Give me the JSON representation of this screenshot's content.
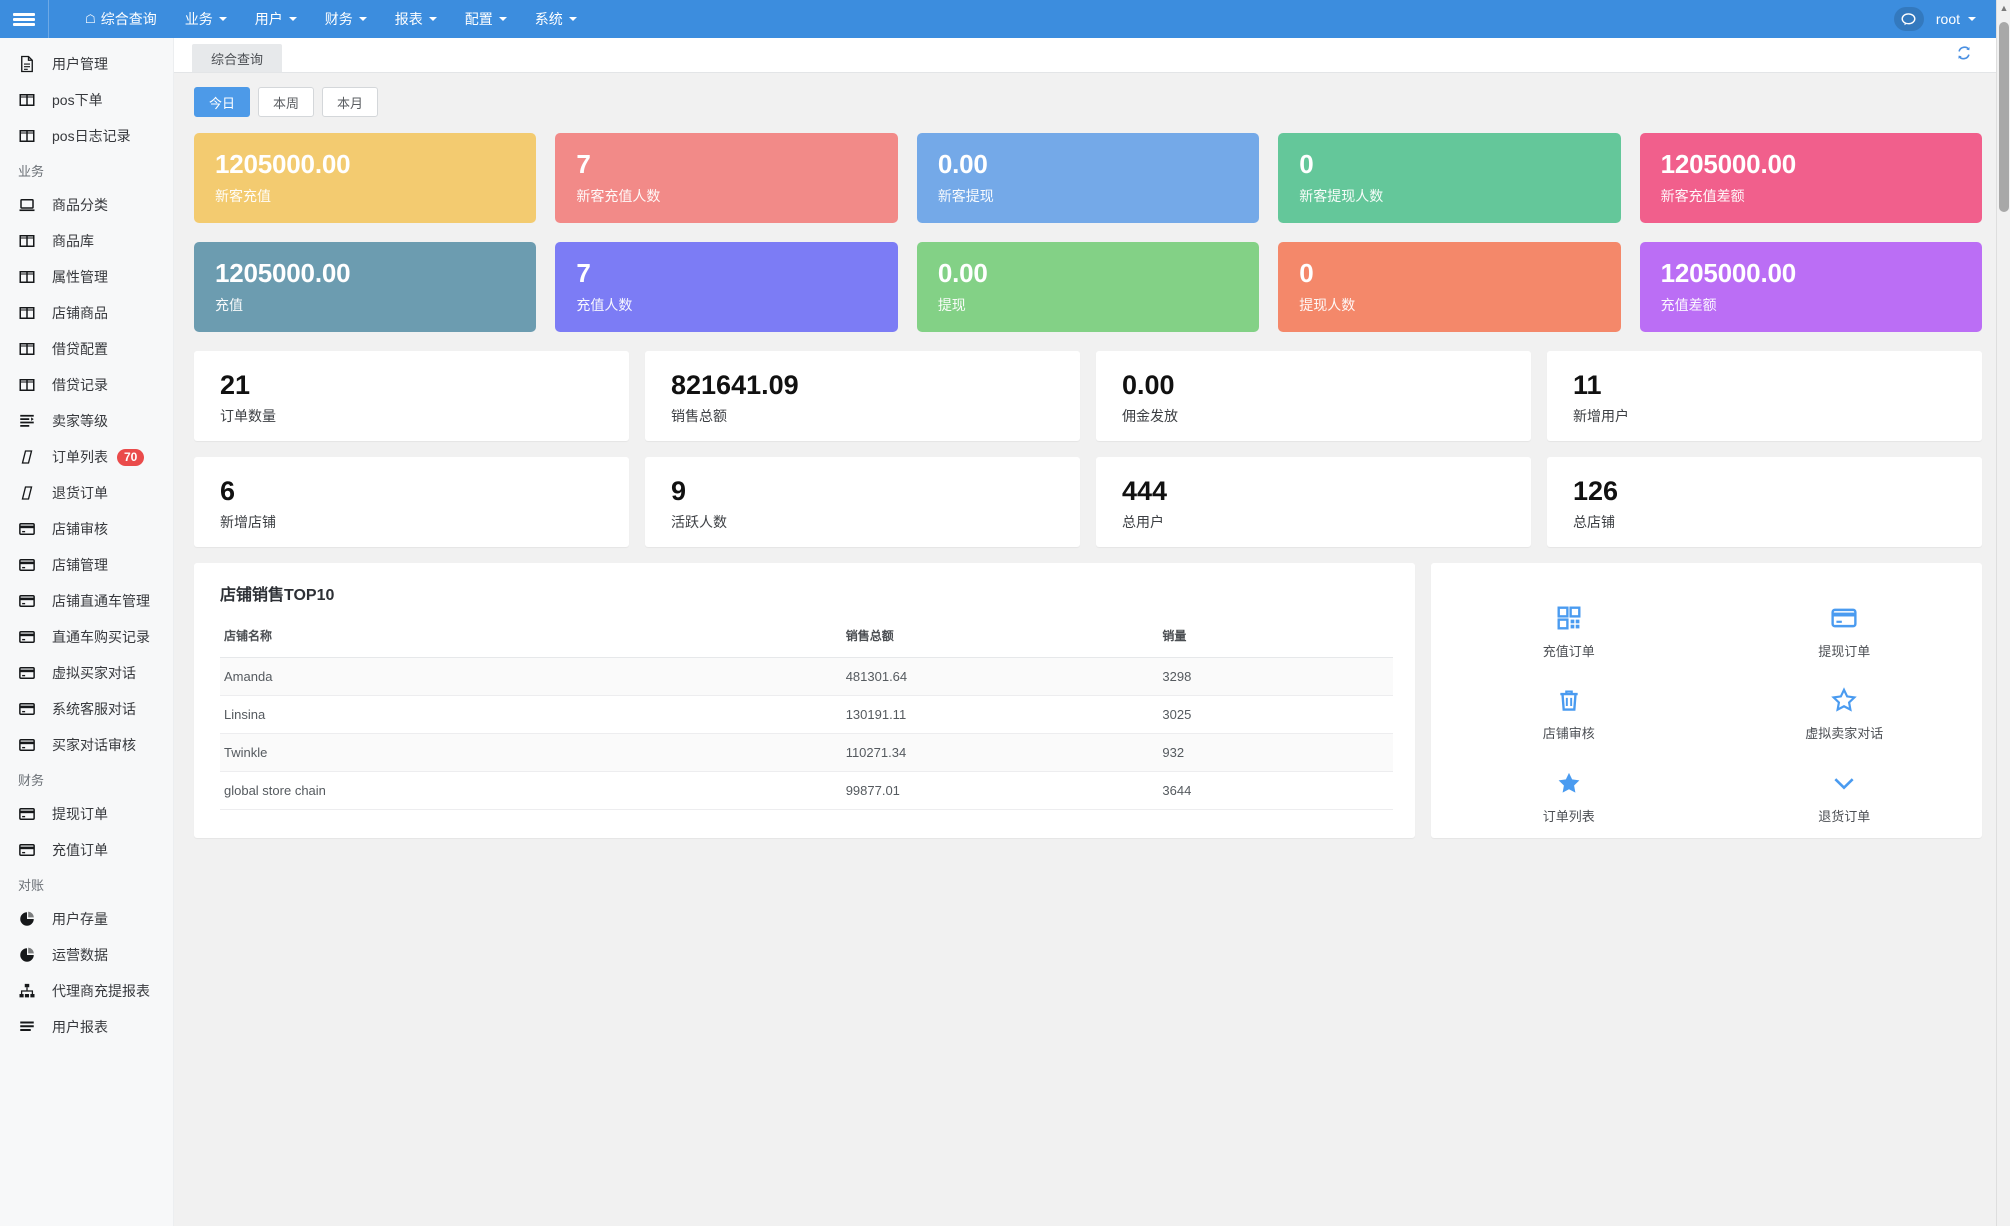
{
  "topbar": {
    "menu_icon": "hamburger-icon",
    "nav": [
      {
        "label": "综合查询",
        "icon": "home-icon",
        "caret": false
      },
      {
        "label": "业务",
        "caret": true
      },
      {
        "label": "用户",
        "caret": true
      },
      {
        "label": "财务",
        "caret": true
      },
      {
        "label": "报表",
        "caret": true
      },
      {
        "label": "配置",
        "caret": true
      },
      {
        "label": "系统",
        "caret": true
      }
    ],
    "chat_icon": "chat-bubble-icon",
    "user": "root",
    "accent": "#3c8dde"
  },
  "sidebar": {
    "items": [
      {
        "label": "用户管理",
        "icon": "document-icon",
        "type": "item"
      },
      {
        "label": "pos下单",
        "icon": "columns-icon",
        "type": "item"
      },
      {
        "label": "pos日志记录",
        "icon": "columns-icon",
        "type": "item"
      },
      {
        "label": "业务",
        "type": "group"
      },
      {
        "label": "商品分类",
        "icon": "laptop-icon",
        "type": "item"
      },
      {
        "label": "商品库",
        "icon": "columns-icon",
        "type": "item"
      },
      {
        "label": "属性管理",
        "icon": "columns-icon",
        "type": "item"
      },
      {
        "label": "店铺商品",
        "icon": "columns-icon",
        "type": "item"
      },
      {
        "label": "借贷配置",
        "icon": "columns-icon",
        "type": "item"
      },
      {
        "label": "借贷记录",
        "icon": "columns-icon",
        "type": "item"
      },
      {
        "label": "卖家等级",
        "icon": "indent-icon",
        "type": "item"
      },
      {
        "label": "订单列表",
        "icon": "slant-icon",
        "type": "item",
        "badge": "70"
      },
      {
        "label": "退货订单",
        "icon": "slant-icon",
        "type": "item"
      },
      {
        "label": "店铺审核",
        "icon": "card-icon",
        "type": "item"
      },
      {
        "label": "店铺管理",
        "icon": "card-icon",
        "type": "item"
      },
      {
        "label": "店铺直通车管理",
        "icon": "card-icon",
        "type": "item"
      },
      {
        "label": "直通车购买记录",
        "icon": "card-icon",
        "type": "item"
      },
      {
        "label": "虚拟买家对话",
        "icon": "card-icon",
        "type": "item"
      },
      {
        "label": "系统客服对话",
        "icon": "card-icon",
        "type": "item"
      },
      {
        "label": "买家对话审核",
        "icon": "card-icon",
        "type": "item"
      },
      {
        "label": "财务",
        "type": "group"
      },
      {
        "label": "提现订单",
        "icon": "card-icon",
        "type": "item"
      },
      {
        "label": "充值订单",
        "icon": "card-icon",
        "type": "item"
      },
      {
        "label": "对账",
        "type": "group"
      },
      {
        "label": "用户存量",
        "icon": "pie-chart-icon",
        "type": "item"
      },
      {
        "label": "运营数据",
        "icon": "pie-chart-icon",
        "type": "item"
      },
      {
        "label": "代理商充提报表",
        "icon": "sitemap-icon",
        "type": "item"
      },
      {
        "label": "用户报表",
        "icon": "list-icon",
        "type": "item"
      }
    ]
  },
  "tabs": {
    "active_label": "综合查询",
    "refresh_icon": "refresh-icon"
  },
  "filters": [
    {
      "label": "今日",
      "active": true
    },
    {
      "label": "本周",
      "active": false
    },
    {
      "label": "本月",
      "active": false
    }
  ],
  "color_cards": [
    [
      {
        "value": "1205000.00",
        "label": "新客充值",
        "color": "#f3cb70"
      },
      {
        "value": "7",
        "label": "新客充值人数",
        "color": "#f28a88"
      },
      {
        "value": "0.00",
        "label": "新客提现",
        "color": "#74a9e8"
      },
      {
        "value": "0",
        "label": "新客提现人数",
        "color": "#64c79a"
      },
      {
        "value": "1205000.00",
        "label": "新客充值差额",
        "color": "#f15f8c"
      }
    ],
    [
      {
        "value": "1205000.00",
        "label": "充值",
        "color": "#6c9cb0"
      },
      {
        "value": "7",
        "label": "充值人数",
        "color": "#7c7cf5"
      },
      {
        "value": "0.00",
        "label": "提现",
        "color": "#83d186"
      },
      {
        "value": "0",
        "label": "提现人数",
        "color": "#f4886a"
      },
      {
        "value": "1205000.00",
        "label": "充值差额",
        "color": "#bb6ef5"
      }
    ]
  ],
  "stat_cards": [
    [
      {
        "value": "21",
        "label": "订单数量"
      },
      {
        "value": "821641.09",
        "label": "销售总额"
      },
      {
        "value": "0.00",
        "label": "佣金发放"
      },
      {
        "value": "11",
        "label": "新增用户"
      }
    ],
    [
      {
        "value": "6",
        "label": "新增店铺"
      },
      {
        "value": "9",
        "label": "活跃人数"
      },
      {
        "value": "444",
        "label": "总用户"
      },
      {
        "value": "126",
        "label": "总店铺"
      }
    ]
  ],
  "top10": {
    "title": "店铺销售TOP10",
    "columns": [
      "店铺名称",
      "销售总额",
      "销量"
    ],
    "rows": [
      {
        "name": "Amanda",
        "total": "481301.64",
        "qty": "3298"
      },
      {
        "name": "Linsina",
        "total": "130191.11",
        "qty": "3025"
      },
      {
        "name": "Twinkle",
        "total": "110271.34",
        "qty": "932"
      },
      {
        "name": "global store chain",
        "total": "99877.01",
        "qty": "3644"
      }
    ]
  },
  "quicklinks": [
    {
      "label": "充值订单",
      "icon": "qrcode-icon"
    },
    {
      "label": "提现订单",
      "icon": "credit-card-icon"
    },
    {
      "label": "店铺审核",
      "icon": "trash-icon"
    },
    {
      "label": "虚拟卖家对话",
      "icon": "star-outline-icon"
    },
    {
      "label": "订单列表",
      "icon": "star-filled-icon"
    },
    {
      "label": "退货订单",
      "icon": "chevron-down-icon"
    }
  ]
}
